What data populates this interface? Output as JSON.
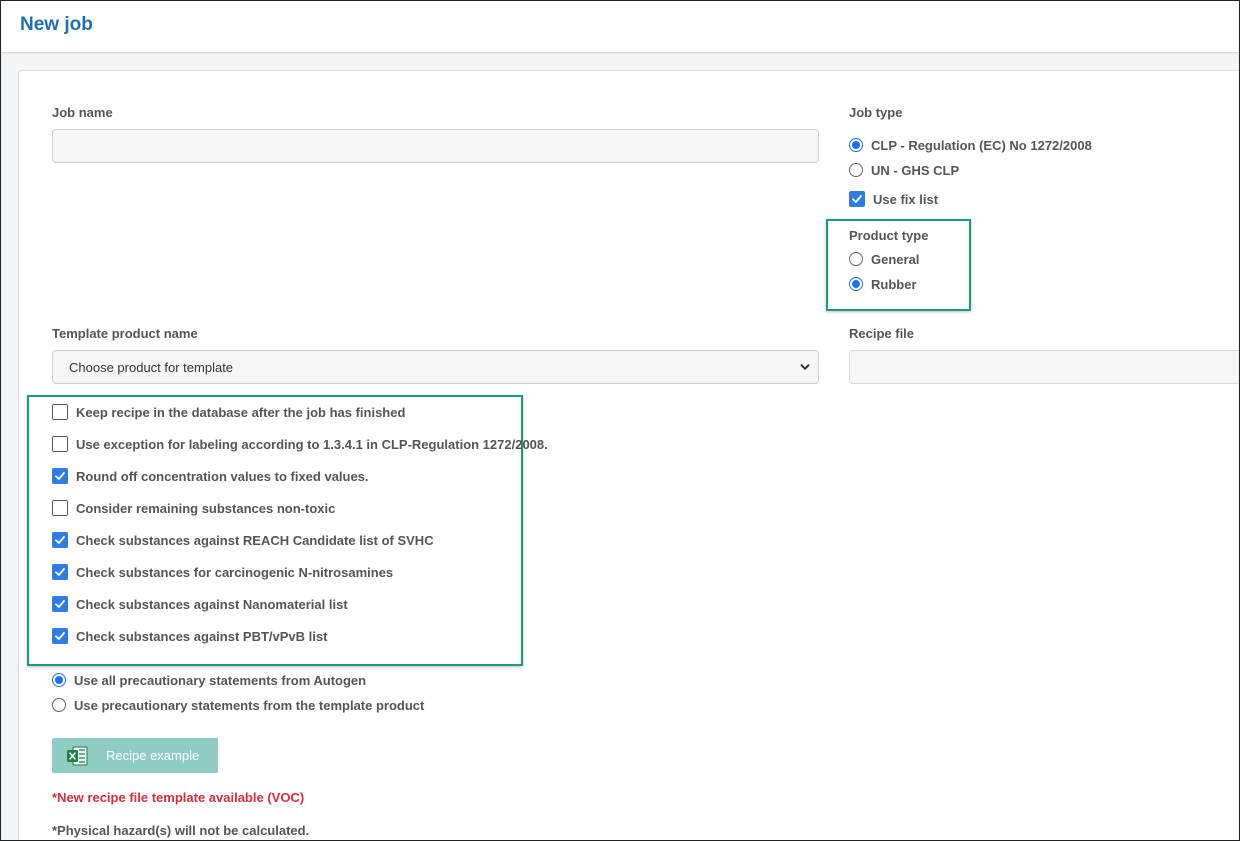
{
  "header": {
    "title": "New job"
  },
  "form": {
    "job_name": {
      "label": "Job name",
      "value": "",
      "placeholder": ""
    },
    "job_type": {
      "label": "Job type",
      "options": [
        {
          "label": "CLP - Regulation (EC) No 1272/2008",
          "selected": true
        },
        {
          "label": "UN - GHS CLP",
          "selected": false
        }
      ],
      "use_fix_list": {
        "label": "Use fix list",
        "checked": true
      }
    },
    "product_type": {
      "label": "Product type",
      "options": [
        {
          "label": "General",
          "selected": false
        },
        {
          "label": "Rubber",
          "selected": true
        }
      ]
    },
    "template_product": {
      "label": "Template product name",
      "selected": "Choose product for template"
    },
    "recipe_file": {
      "label": "Recipe file",
      "value": ""
    },
    "checkboxes": [
      {
        "label": "Keep recipe in the database after the job has finished",
        "checked": false
      },
      {
        "label": "Use exception for labeling according to 1.3.4.1 in CLP-Regulation 1272/2008.",
        "checked": false
      },
      {
        "label": "Round off concentration values to fixed values.",
        "checked": true
      },
      {
        "label": "Consider remaining substances non-toxic",
        "checked": false
      },
      {
        "label": "Check substances against REACH Candidate list of SVHC",
        "checked": true
      },
      {
        "label": "Check substances for carcinogenic N-nitrosamines",
        "checked": true
      },
      {
        "label": "Check substances against Nanomaterial list",
        "checked": true
      },
      {
        "label": "Check substances against PBT/vPvB list",
        "checked": true
      }
    ],
    "precautionary": {
      "options": [
        {
          "label": "Use all precautionary statements from Autogen",
          "selected": true
        },
        {
          "label": "Use precautionary statements from the template product",
          "selected": false
        }
      ]
    },
    "recipe_button": {
      "label": "Recipe example",
      "icon": "excel-icon"
    },
    "notes": {
      "new_template": "*New recipe file template available (VOC)",
      "physical_hazard": "*Physical hazard(s) will not be calculated."
    }
  },
  "colors": {
    "title": "#1f6fb2",
    "accent": "#1a73e8",
    "highlight": "#1a9b7a",
    "button": "#8fcdc4",
    "warning": "#dc2d3b"
  }
}
